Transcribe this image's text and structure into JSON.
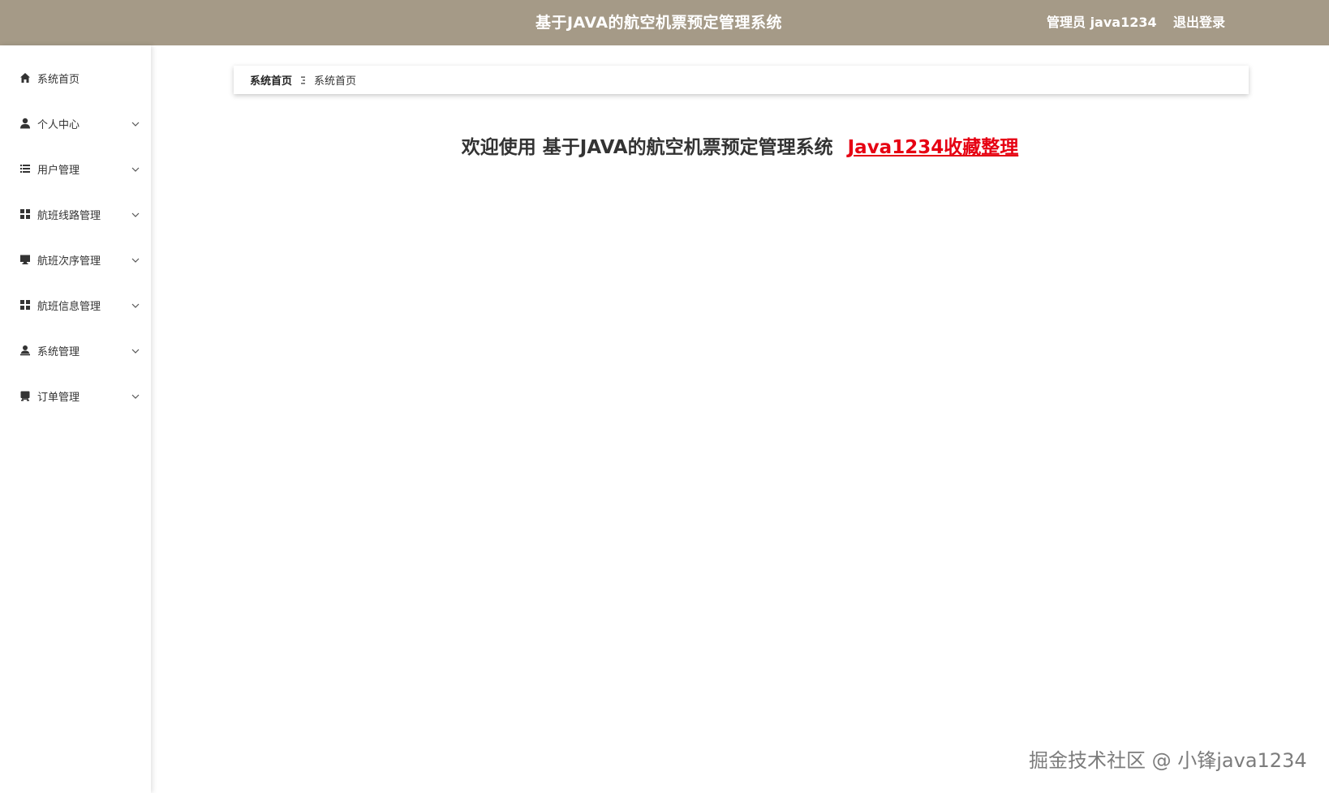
{
  "header": {
    "title": "基于JAVA的航空机票预定管理系统",
    "user_label": "管理员 java1234",
    "logout_label": "退出登录",
    "bg_color": "#a59a87"
  },
  "sidebar": {
    "items": [
      {
        "label": "系统首页",
        "icon": "home-icon",
        "expandable": false
      },
      {
        "label": "个人中心",
        "icon": "user-icon",
        "expandable": true
      },
      {
        "label": "用户管理",
        "icon": "list-icon",
        "expandable": true
      },
      {
        "label": "航班线路管理",
        "icon": "grid-icon",
        "expandable": true
      },
      {
        "label": "航班次序管理",
        "icon": "monitor-icon",
        "expandable": true
      },
      {
        "label": "航班信息管理",
        "icon": "grid-icon",
        "expandable": true
      },
      {
        "label": "系统管理",
        "icon": "admin-user-icon",
        "expandable": true
      },
      {
        "label": "订单管理",
        "icon": "order-icon",
        "expandable": true
      }
    ]
  },
  "breadcrumb": {
    "home": "系统首页",
    "current": "系统首页"
  },
  "welcome": {
    "text": "欢迎使用 基于JAVA的航空机票预定管理系统",
    "link_text": "Java1234收藏整理",
    "link_color": "#e60012"
  },
  "watermark": {
    "text": "掘金技术社区 @ 小锋java1234"
  }
}
